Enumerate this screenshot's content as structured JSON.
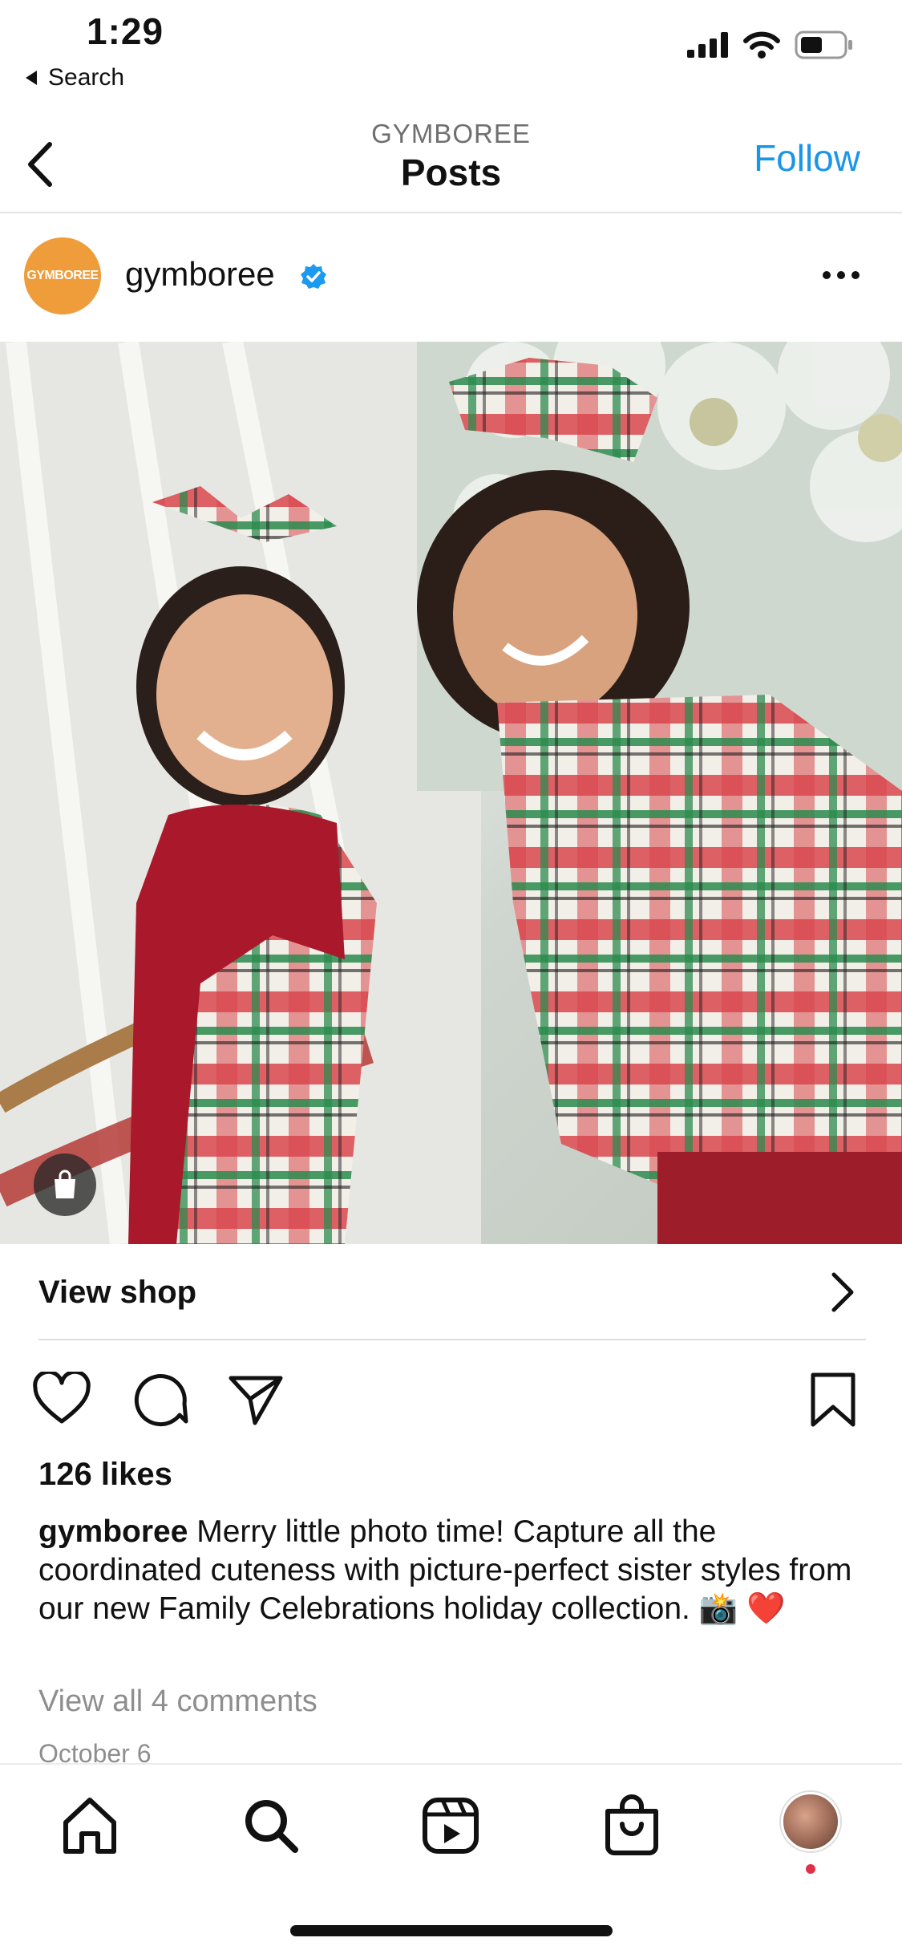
{
  "status_bar": {
    "time": "1:29",
    "back_label": "Search",
    "icons": [
      "signal-icon",
      "wifi-icon",
      "battery-icon"
    ]
  },
  "nav": {
    "subtitle": "GYMBOREE",
    "title": "Posts",
    "follow_label": "Follow",
    "back_icon": "chevron-left-icon"
  },
  "post": {
    "avatar_text": "GYMBOREE",
    "username": "gymboree",
    "verified": true,
    "more_icon": "ellipsis-icon",
    "shop_bubble_icon": "shopping-bag-icon",
    "view_shop_label": "View shop",
    "likes": "126 likes",
    "caption_user": "gymboree",
    "caption_text": " Merry little photo time! Capture all the coordinated cuteness with picture-perfect sister styles from our new Family Celebrations holiday collection. 📸 ❤️",
    "comments_link": "View all 4 comments",
    "date": "October 6"
  },
  "colors": {
    "accent": "#1b95e8",
    "avatar_bg": "#ef9c3b",
    "notification_dot": "#e0314a"
  },
  "tabs": [
    {
      "name": "home",
      "icon": "home-icon"
    },
    {
      "name": "search",
      "icon": "search-icon"
    },
    {
      "name": "reels",
      "icon": "reels-icon"
    },
    {
      "name": "shop",
      "icon": "shopping-bag-icon"
    },
    {
      "name": "profile",
      "icon": "avatar"
    }
  ]
}
